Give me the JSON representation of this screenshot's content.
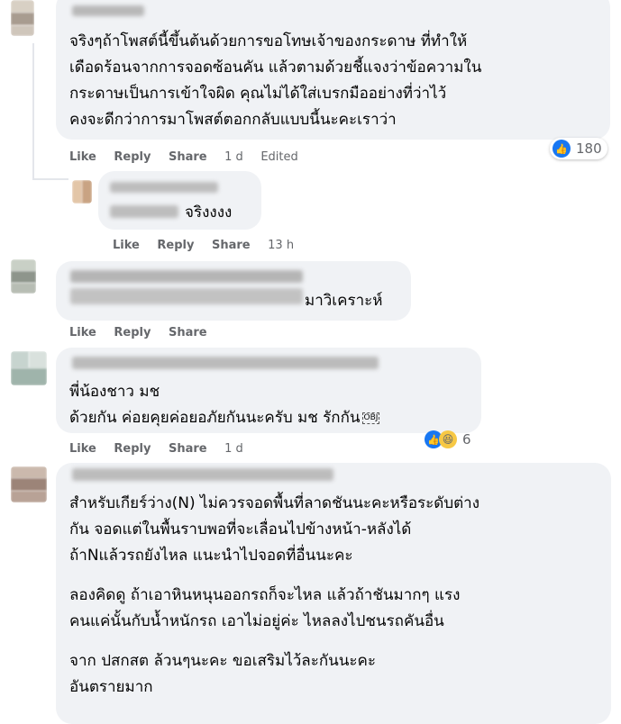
{
  "comments": [
    {
      "lines": [
        "จริงๆถ้าโพสต์นี้ขึ้นต้นด้วยการขอโทษเจ้าของกระดาษ ที่ทำให้",
        "เดือดร้อนจากการจอดซ้อนคัน แล้วตามด้วยชี้แจงว่าข้อความใน",
        "กระดาษเป็นการเข้าใจผิด คุณไม่ได้ใส่เบรกมืออย่างที่ว่าไว้",
        "คงจะดีกว่าการมาโพสต์ตอกกลับแบบนี้นะคะเราว่า"
      ],
      "actions": {
        "like": "Like",
        "reply": "Reply",
        "share": "Share",
        "time": "1 d",
        "edited": "Edited"
      },
      "reaction_count": "180"
    },
    {
      "text": "จริงงงง",
      "actions": {
        "like": "Like",
        "reply": "Reply",
        "share": "Share",
        "time": "13 h"
      }
    },
    {
      "text": "มาวิเคราะห์",
      "actions": {
        "like": "Like",
        "reply": "Reply",
        "share": "Share"
      }
    },
    {
      "lines": [
        "พี่น้องชาว มช",
        "ด้วยกัน ค่อยคุยค่อยอภัยกันนะครับ มช รักกัน"
      ],
      "obj_marker": "OBJ",
      "actions": {
        "like": "Like",
        "reply": "Reply",
        "share": "Share",
        "time": "1 d"
      },
      "reaction_count": "6"
    },
    {
      "paragraphs": [
        [
          "สำหรับเกียร์ว่าง(N) ไม่ควรจอดพื้นที่ลาดชันนะคะหรือระดับต่าง",
          "กัน จอดแต่ในพื้นราบพอที่จะเลื่อนไปข้างหน้า-หลังได้",
          "ถ้าNแล้วรถยังไหล แนะนำไปจอดที่อื่นนะคะ"
        ],
        [
          "ลองคิดดู ถ้าเอาหินหนุนออกรถก็จะไหล แล้วถ้าชันมากๆ แรง",
          "คนแค่นั้นกับน้ำหนักรถ เอาไม่อยู่ค่ะ ไหลลงไปชนรถคันอื่น"
        ],
        [
          "จาก ปสกสต ล้วนๆนะคะ ขอเสริมไว้ละกันนะคะ",
          "อันตรายมาก"
        ]
      ]
    }
  ],
  "colors": {
    "bubble": "#f0f2f5",
    "meta": "#65676b",
    "like_blue": "#1877f2",
    "haha_yellow": "#f7c844"
  },
  "icons": [
    "like-reaction-icon",
    "haha-reaction-icon"
  ]
}
